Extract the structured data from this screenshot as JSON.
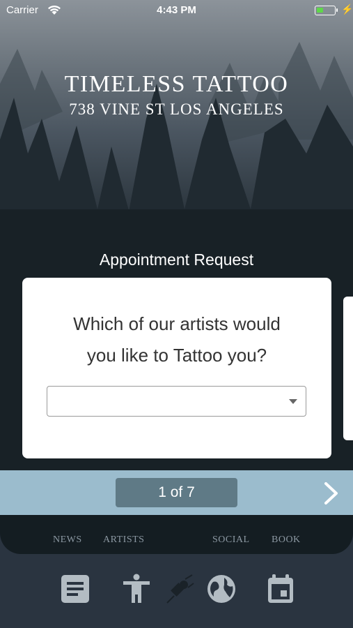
{
  "status_bar": {
    "carrier": "Carrier",
    "time": "4:43 PM",
    "battery_color": "#5fd84a"
  },
  "header": {
    "title": "TIMELESS TATTOO",
    "address": "738 VINE ST LOS ANGELES"
  },
  "section_label": "Appointment Request",
  "card": {
    "question_line1": "Which of our artists would",
    "question_line2": "you like to Tattoo you?",
    "select_value": ""
  },
  "pager": {
    "indicator": "1 of 7"
  },
  "tabs": [
    {
      "label": "NEWS",
      "icon": "news-icon"
    },
    {
      "label": "ARTISTS",
      "icon": "person-icon"
    },
    {
      "label": "",
      "icon": "tattoo-machine-icon"
    },
    {
      "label": "SOCIAL",
      "icon": "globe-icon"
    },
    {
      "label": "BOOK",
      "icon": "calendar-icon"
    }
  ],
  "colors": {
    "pager_bg": "#9bbccd",
    "badge_bg": "#5f7a86",
    "tab_icon": "#b3bcc3"
  }
}
